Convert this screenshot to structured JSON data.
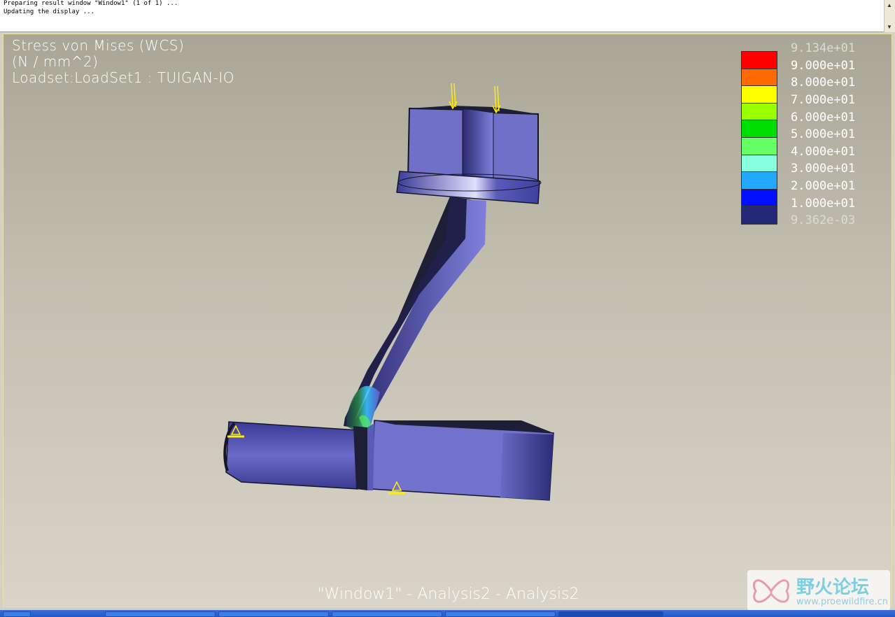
{
  "messages": {
    "line1": "Preparing result window \"Window1\" (1 of 1) ...",
    "line2": "Updating the display ..."
  },
  "overlay": {
    "title_line1": "Stress von Mises (WCS)",
    "title_line2": "(N / mm^2)",
    "title_line3": "Loadset:LoadSet1 :  TUIGAN-IO"
  },
  "legend": {
    "labels": [
      "9.134e+01",
      "9.000e+01",
      "8.000e+01",
      "7.000e+01",
      "6.000e+01",
      "5.000e+01",
      "4.000e+01",
      "3.000e+01",
      "2.000e+01",
      "1.000e+01",
      "9.362e-03"
    ],
    "colors": [
      "#ff0000",
      "#ff6a00",
      "#ffff00",
      "#9aff00",
      "#00dd00",
      "#66ff66",
      "#88ffdd",
      "#22a8ff",
      "#0010ff",
      "#252878"
    ]
  },
  "footer": {
    "text": "\"Window1\"  -  Analysis2  -  Analysis2"
  },
  "watermark": {
    "brand": "野火论坛",
    "url": "www.proewildfire.cn"
  },
  "colors": {
    "model_main": "#7070c8",
    "model_dark": "#1e1e36",
    "constraint": "#ffee00"
  }
}
